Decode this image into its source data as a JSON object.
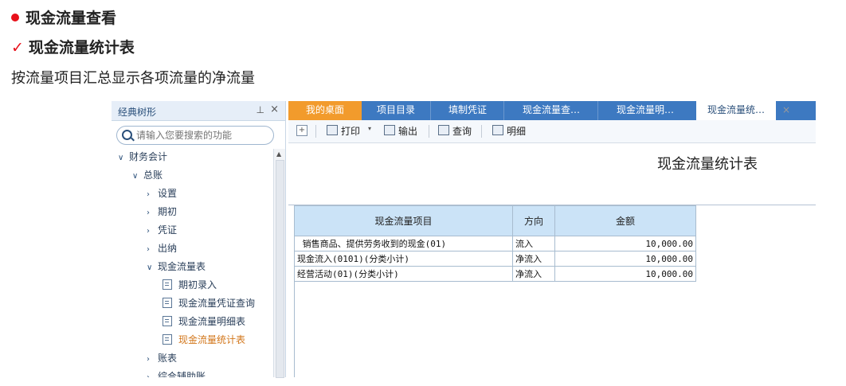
{
  "doc": {
    "heading1": "现金流量查看",
    "heading2": "现金流量统计表",
    "check_mark": "✓",
    "description": "按流量项目汇总显示各项流量的净流量"
  },
  "sidebar": {
    "title": "经典树形",
    "pin_glyph": "⊥",
    "close_glyph": "×",
    "search_placeholder": "请输入您要搜索的功能",
    "tree": [
      {
        "label": "财务会计",
        "arrow": "∨"
      },
      {
        "label": "总账",
        "arrow": "∨"
      },
      {
        "label": "设置",
        "arrow": "›"
      },
      {
        "label": "期初",
        "arrow": "›"
      },
      {
        "label": "凭证",
        "arrow": "›"
      },
      {
        "label": "出纳",
        "arrow": "›"
      },
      {
        "label": "现金流量表",
        "arrow": "∨"
      },
      {
        "label": "期初录入"
      },
      {
        "label": "现金流量凭证查询"
      },
      {
        "label": "现金流量明细表"
      },
      {
        "label": "现金流量统计表",
        "active": true
      },
      {
        "label": "账表",
        "arrow": "›"
      },
      {
        "label": "综合辅助账",
        "arrow": "›"
      }
    ]
  },
  "tabs": [
    {
      "label": "我的桌面"
    },
    {
      "label": "项目目录"
    },
    {
      "label": "填制凭证"
    },
    {
      "label": "现金流量查…"
    },
    {
      "label": "现金流量明…"
    },
    {
      "label": "现金流量统…",
      "close": "×"
    }
  ],
  "toolbar": {
    "plus": "+",
    "print_label": "打印",
    "export_label": "输出",
    "query_label": "查询",
    "detail_label": "明细",
    "dropdown_glyph": "▾"
  },
  "report": {
    "title": "现金流量统计表",
    "columns": [
      "现金流量项目",
      "方向",
      "金额"
    ],
    "rows": [
      {
        "item": " 销售商品、提供劳务收到的现金(01)",
        "direction": "流入",
        "amount": "10,000.00"
      },
      {
        "item": "现金流入(0101)(分类小计)",
        "direction": "净流入",
        "amount": "10,000.00"
      },
      {
        "item": "经营活动(01)(分类小计)",
        "direction": "净流入",
        "amount": "10,000.00"
      }
    ]
  },
  "colors": {
    "accent_red": "#e8101a",
    "tab_bar": "#3d79c1",
    "home_tab": "#f29b2c",
    "table_header": "#cbe3f7",
    "active_tree_item": "#d2761a"
  }
}
